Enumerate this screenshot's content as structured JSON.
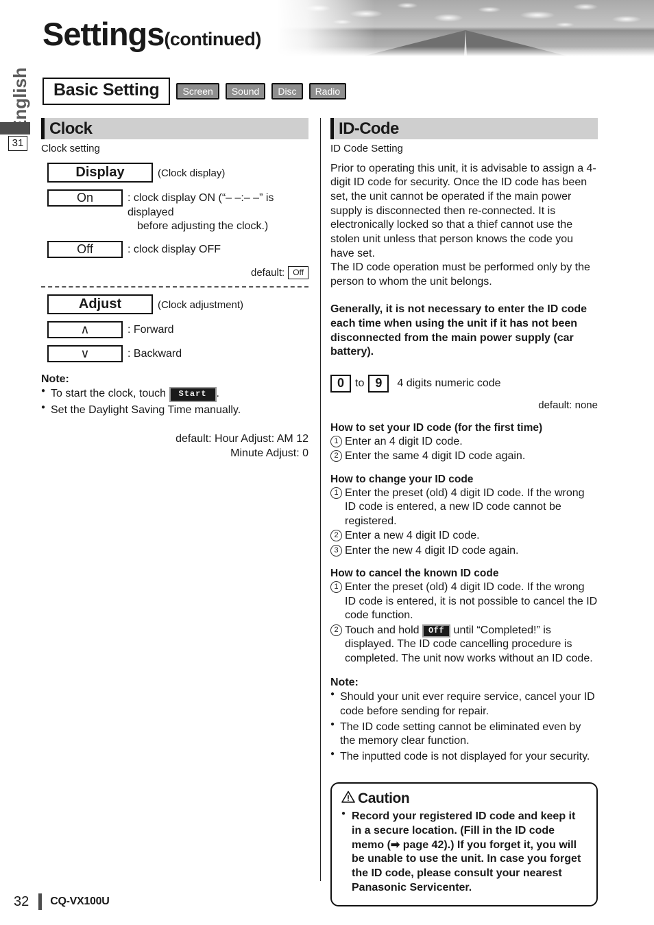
{
  "header": {
    "title": "Settings",
    "title_suffix": "(continued)",
    "language_tab": "English",
    "page_marker": "31"
  },
  "basic_setting": {
    "label": "Basic Setting",
    "tabs": [
      {
        "label": "Screen"
      },
      {
        "label": "Sound"
      },
      {
        "label": "Disc"
      },
      {
        "label": "Radio"
      }
    ]
  },
  "clock": {
    "heading": "Clock",
    "subtitle": "Clock setting",
    "display": {
      "key": "Display",
      "caption": "(Clock display)",
      "options": [
        {
          "key": "On",
          "desc_line1": ": clock display ON (“– –:– –” is displayed",
          "desc_line2": "before adjusting the clock.)"
        },
        {
          "key": "Off",
          "desc_line1": ": clock display OFF",
          "desc_line2": ""
        }
      ],
      "default_label": "default:",
      "default_value": "Off"
    },
    "adjust": {
      "key": "Adjust",
      "caption": "(Clock adjustment)",
      "options": [
        {
          "key": "∧",
          "desc": ": Forward"
        },
        {
          "key": "∨",
          "desc": ": Backward"
        }
      ]
    },
    "note": {
      "title": "Note:",
      "items": [
        {
          "before": "To start the clock, touch ",
          "button": "Start",
          "after": "."
        },
        {
          "before": "Set the Daylight Saving Time manually.",
          "button": "",
          "after": ""
        }
      ]
    },
    "defaults": {
      "line1": "default: Hour Adjust: AM 12",
      "line2": "Minute Adjust: 0"
    }
  },
  "id_code": {
    "heading": "ID-Code",
    "subtitle": "ID Code Setting",
    "paragraphs": [
      "Prior to operating this unit, it is advisable to assign a 4-digit ID code for security. Once the ID code has been set, the unit cannot be operated if the main power supply is disconnected then re-connected. It is electronically locked so that a thief cannot use the stolen unit unless that person knows the code you have set.",
      "The ID code operation must be performed only by the person to whom the unit belongs."
    ],
    "bold_paragraph": "Generally, it is not necessary to enter the ID code each time when using the unit if it has not been disconnected from the main power supply (car battery).",
    "code_range": {
      "from": "0",
      "to_label": "to",
      "to": "9",
      "desc": "4 digits numeric code"
    },
    "default_text": "default: none",
    "sections": [
      {
        "title": "How to set your ID code (for the first time)",
        "steps": [
          {
            "num": "1",
            "text": "Enter an 4 digit ID code."
          },
          {
            "num": "2",
            "text": "Enter the same 4 digit ID code again."
          }
        ]
      },
      {
        "title": "How to change your ID code",
        "steps": [
          {
            "num": "1",
            "text": "Enter the preset (old) 4 digit ID code. If the wrong ID code is entered, a new ID code cannot be registered."
          },
          {
            "num": "2",
            "text": "Enter a new 4 digit ID code."
          },
          {
            "num": "3",
            "text": "Enter the new 4 digit ID code again."
          }
        ]
      },
      {
        "title": "How to cancel the known ID code",
        "steps": [
          {
            "num": "1",
            "text": "Enter the preset (old) 4 digit ID code. If the wrong ID code is entered, it is not possible to cancel the ID code function."
          },
          {
            "num": "2",
            "text_before": "Touch and hold ",
            "button": "Off",
            "text_after": " until “Completed!” is displayed. The ID code cancelling procedure is completed. The unit now works without an ID code."
          }
        ]
      }
    ],
    "note": {
      "title": "Note:",
      "items": [
        "Should your unit ever require service, cancel your ID code before sending for repair.",
        "The ID code setting cannot be eliminated even by the memory clear function.",
        "The inputted code is not displayed for your security."
      ]
    },
    "caution": {
      "icon": "warning-triangle-icon",
      "title": "Caution",
      "items": [
        "Record your registered ID code and keep it in a secure location. (Fill in the ID code memo (➡ page 42).) If you forget it, you will be unable to use the unit. In case you forget the ID code, please consult your nearest Panasonic Servicenter."
      ]
    }
  },
  "footer": {
    "page_number": "32",
    "model": "CQ-VX100U"
  }
}
